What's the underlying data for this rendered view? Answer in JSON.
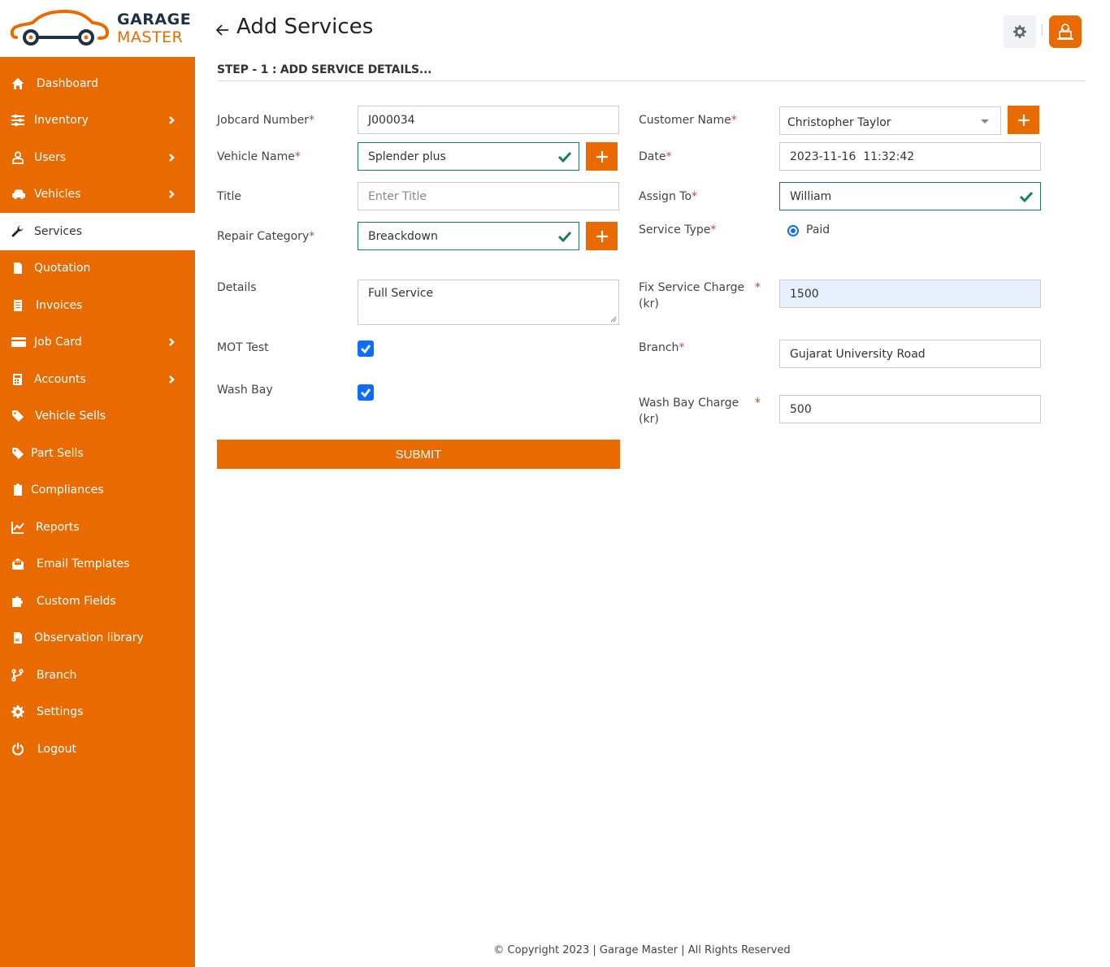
{
  "brand": {
    "line1": "GARAGE",
    "line2": "MASTER",
    "accent_color": "#e96b00",
    "dark_color": "#1e3246"
  },
  "sidebar": {
    "items": [
      {
        "label": "Dashboard",
        "icon": "home-icon",
        "has_submenu": false,
        "active": false
      },
      {
        "label": "Inventory",
        "icon": "sliders-icon",
        "has_submenu": true,
        "active": false
      },
      {
        "label": "Users",
        "icon": "user-icon",
        "has_submenu": true,
        "active": false
      },
      {
        "label": "Vehicles",
        "icon": "car-icon",
        "has_submenu": true,
        "active": false
      },
      {
        "label": "Services",
        "icon": "wrench-icon",
        "has_submenu": false,
        "active": true
      },
      {
        "label": "Quotation",
        "icon": "file-invoice-icon",
        "has_submenu": false,
        "active": false
      },
      {
        "label": "Invoices",
        "icon": "receipt-icon",
        "has_submenu": false,
        "active": false
      },
      {
        "label": "Job Card",
        "icon": "credit-card-icon",
        "has_submenu": true,
        "active": false
      },
      {
        "label": "Accounts",
        "icon": "calculator-icon",
        "has_submenu": true,
        "active": false
      },
      {
        "label": "Vehicle Sells",
        "icon": "tag-icon",
        "has_submenu": false,
        "active": false
      },
      {
        "label": "Part Sells",
        "icon": "tag-icon",
        "has_submenu": false,
        "active": false
      },
      {
        "label": "Compliances",
        "icon": "clipboard-check-icon",
        "has_submenu": false,
        "active": false
      },
      {
        "label": "Reports",
        "icon": "line-chart-icon",
        "has_submenu": false,
        "active": false
      },
      {
        "label": "Email Templates",
        "icon": "envelope-open-icon",
        "has_submenu": false,
        "active": false
      },
      {
        "label": "Custom Fields",
        "icon": "puzzle-icon",
        "has_submenu": false,
        "active": false
      },
      {
        "label": "Observation library",
        "icon": "document-icon",
        "has_submenu": false,
        "active": false
      },
      {
        "label": "Branch",
        "icon": "code-branch-icon",
        "has_submenu": false,
        "active": false
      },
      {
        "label": "Settings",
        "icon": "gear-icon",
        "has_submenu": false,
        "active": false
      },
      {
        "label": "Logout",
        "icon": "power-icon",
        "has_submenu": false,
        "active": false
      }
    ]
  },
  "header": {
    "title": "Add Services",
    "back_icon": "arrow-left-icon",
    "settings_icon": "gear-icon",
    "avatar_icon": "user-at-desk-icon"
  },
  "form": {
    "step_title": "STEP - 1 : ADD SERVICE DETAILS...",
    "left": {
      "jobcard_number": {
        "label": "Jobcard Number",
        "required": "*",
        "value": "J000034"
      },
      "vehicle_name": {
        "label": "Vehicle Name",
        "required": "*",
        "value": "Splender plus"
      },
      "title": {
        "label": "Title",
        "placeholder": "Enter Title",
        "value": ""
      },
      "repair_category": {
        "label": "Repair Category",
        "required": "*",
        "value": "Breackdown"
      },
      "details": {
        "label": "Details",
        "value": "Full Service"
      },
      "mot_test": {
        "label": "MOT Test",
        "checked": true
      },
      "wash_bay": {
        "label": "Wash Bay",
        "checked": true
      }
    },
    "right": {
      "customer_name": {
        "label": "Customer Name",
        "required": "*",
        "value": "Christopher Taylor"
      },
      "date": {
        "label": "Date",
        "required": "*",
        "value": "2023-11-16  11:32:42"
      },
      "assign_to": {
        "label": "Assign To",
        "required": "*",
        "value": "William"
      },
      "service_type": {
        "label": "Service Type",
        "required": "*",
        "option": "Paid",
        "selected": true
      },
      "fix_service_charge": {
        "label_line1": "Fix Service Charge",
        "label_line2": "(kr)",
        "required": "*",
        "value": "1500"
      },
      "branch": {
        "label": "Branch",
        "required": "*",
        "value": "Gujarat University Road"
      },
      "wash_bay_charge": {
        "label_line1": "Wash Bay Charge",
        "label_line2": "(kr)",
        "required": "*",
        "value": "500"
      }
    },
    "submit_label": "SUBMIT"
  },
  "footer": {
    "text": "© Copyright 2023 | Garage Master | All Rights Reserved"
  }
}
